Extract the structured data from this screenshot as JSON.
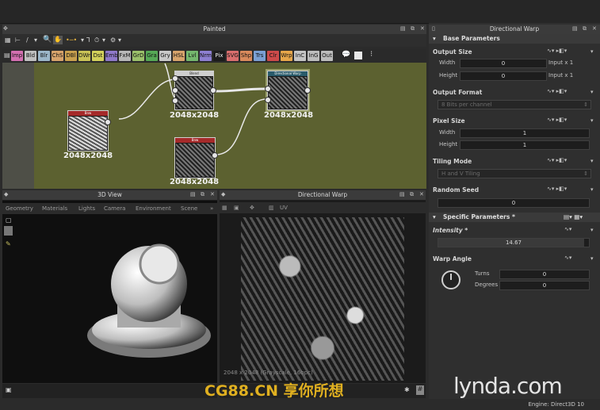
{
  "graph_panel": {
    "title": "Painted"
  },
  "filter_buttons": [
    {
      "label": "Imp",
      "color": "#d36fb0"
    },
    {
      "label": "Bld",
      "color": "#bfbfbf"
    },
    {
      "label": "Blr",
      "color": "#9bb6c9"
    },
    {
      "label": "ChS",
      "color": "#d7a36b"
    },
    {
      "label": "DBl",
      "color": "#c9a04e"
    },
    {
      "label": "DWr",
      "color": "#c9c256"
    },
    {
      "label": "Dst",
      "color": "#d2d05a"
    },
    {
      "label": "Emb",
      "color": "#8f79c9"
    },
    {
      "label": "FxM",
      "color": "#b7b7b7"
    },
    {
      "label": "GrD",
      "color": "#9bc06a"
    },
    {
      "label": "Gra",
      "color": "#56a856"
    },
    {
      "label": "Gry",
      "color": "#c9c9c9"
    },
    {
      "label": "HSL",
      "color": "#d7a36b"
    },
    {
      "label": "Lvl",
      "color": "#74b76d"
    },
    {
      "label": "Nrm",
      "color": "#8d7fd1"
    },
    {
      "label": "Pix",
      "color": "#1b1b1b"
    },
    {
      "label": "SVG",
      "color": "#d96e6e"
    },
    {
      "label": "Shp",
      "color": "#d98a5c"
    },
    {
      "label": "Trs",
      "color": "#7a9fd3"
    },
    {
      "label": "Clr",
      "color": "#cc4a4a"
    },
    {
      "label": "Wrp",
      "color": "#e6a64a"
    },
    {
      "label": "InC",
      "color": "#c4c4c4"
    },
    {
      "label": "InG",
      "color": "#bcbcbc"
    },
    {
      "label": "Out",
      "color": "#bcbcbc"
    }
  ],
  "nodes": [
    {
      "title": "Blend",
      "size": "2048x2048"
    },
    {
      "title": "Directional Warp",
      "size": "2048x2048"
    },
    {
      "title": "Bnw",
      "size": "2048x2048"
    },
    {
      "title": "Bnw",
      "size": "2048x2048"
    }
  ],
  "view3d": {
    "title": "3D View",
    "menu": [
      "Geometry",
      "Materials",
      "Lights",
      "Camera",
      "Environment",
      "Scene"
    ]
  },
  "view2d": {
    "title": "Directional Warp",
    "tool": "UV",
    "status": "2048 x 2048 (Grayscale, 16bpc)"
  },
  "props": {
    "title": "Directional Warp",
    "base_section": "Base Parameters",
    "output_size": {
      "label": "Output Size",
      "width_label": "Width",
      "width_value": "0",
      "width_suffix": "Input x 1",
      "height_label": "Height",
      "height_value": "0",
      "height_suffix": "Input x 1"
    },
    "output_format": {
      "label": "Output Format",
      "value": "8 Bits per channel"
    },
    "pixel_size": {
      "label": "Pixel Size",
      "width_label": "Width",
      "width_value": "1",
      "height_label": "Height",
      "height_value": "1"
    },
    "tiling_mode": {
      "label": "Tiling Mode",
      "value": "H and V Tiling"
    },
    "random_seed": {
      "label": "Random Seed",
      "value": "0"
    },
    "specific_section": "Specific Parameters *",
    "intensity": {
      "label": "Intensity *",
      "value": "14.67",
      "fraction": 0.97
    },
    "warp_angle": {
      "label": "Warp Angle",
      "turns_label": "Turns",
      "turns_value": "0",
      "degrees_label": "Degrees",
      "degrees_value": "0"
    }
  },
  "statusbar": {
    "engine": "Engine: Direct3D 10"
  },
  "watermarks": {
    "left": "CG88.CN 享你所想",
    "right": "lynda.com"
  }
}
